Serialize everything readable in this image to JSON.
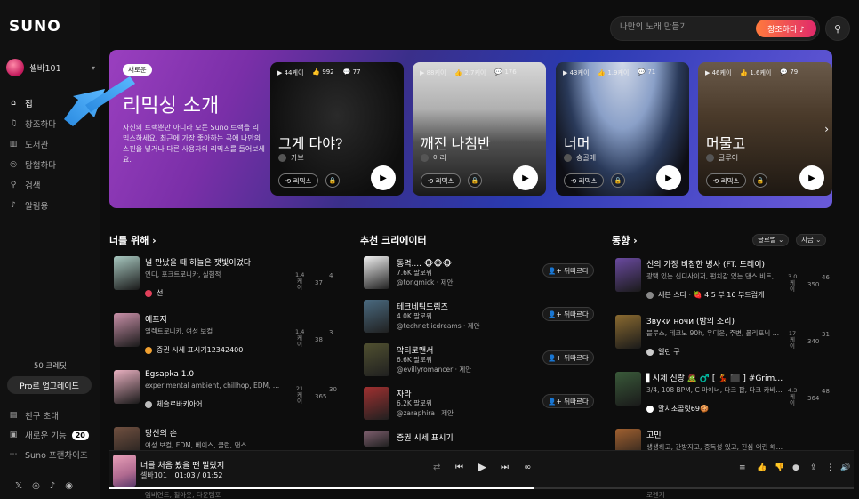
{
  "brand": "SUNO",
  "profile": {
    "name": "셀바101"
  },
  "nav": [
    {
      "icon": "home-icon",
      "glyph": "⌂",
      "label": "집"
    },
    {
      "icon": "music-note-icon",
      "glyph": "♫",
      "label": "창조하다"
    },
    {
      "icon": "library-icon",
      "glyph": "▥",
      "label": "도서관"
    },
    {
      "icon": "compass-icon",
      "glyph": "◎",
      "label": "탐험하다"
    },
    {
      "icon": "search-icon",
      "glyph": "⚲",
      "label": "검색"
    },
    {
      "icon": "bell-icon",
      "glyph": "♪",
      "label": "알림용"
    }
  ],
  "credits": "50 크레딧",
  "pro_button": "Pro로 업그레이드",
  "sub_nav": [
    {
      "icon": "invite-icon",
      "glyph": "▤",
      "label": "친구 초대"
    },
    {
      "icon": "gift-icon",
      "glyph": "▣",
      "label": "새로운 기능",
      "badge": "20"
    },
    {
      "icon": "dots-icon",
      "glyph": "⋯",
      "label": "Suno 프랜차이즈"
    }
  ],
  "socials": [
    "𝕏",
    "◎",
    "♪",
    "◉"
  ],
  "topbar": {
    "placeholder": "나만의 노래 만들기",
    "create": "창조하다 ♪",
    "search": "⚲"
  },
  "hero": {
    "badge": "새로운",
    "title": "리믹싱 소개",
    "desc": "자신의 트랙뿐만 아니라 모든 Suno 트랙을 리믹스하세요. 최근에 가장 좋아하는 곡에 나만의 스핀을 넣거나 다른 사용자의 리믹스를 들어보세요.",
    "cards": [
      {
        "plays": "▶ 44케이",
        "likes": "👍 992",
        "comments": "💬 77",
        "title": "그게 다야?",
        "artist": "카브",
        "remix": "⟲ 리믹스",
        "lock": "🔒",
        "play": "▶",
        "accent": "#3a3a3a"
      },
      {
        "plays": "▶ 88케이",
        "likes": "👍 2.7케이",
        "comments": "💬 176",
        "title": "깨진 나침반",
        "artist": "아리",
        "remix": "⟲ 리믹스",
        "lock": "🔒",
        "play": "▶",
        "accent": "#707070"
      },
      {
        "plays": "▶ 43케이",
        "likes": "👍 1.9케이",
        "comments": "💬 71",
        "title": "너머",
        "artist": "송골매",
        "remix": "⟲ 리믹스",
        "lock": "🔒",
        "play": "▶",
        "accent": "#8aa0c8"
      },
      {
        "plays": "▶ 46케이",
        "likes": "👍 1.6케이",
        "comments": "💬 79",
        "title": "머물고",
        "artist": "글루어",
        "remix": "⟲ 리믹스",
        "lock": "🔒",
        "play": "▶",
        "accent": "#6a5040"
      }
    ]
  },
  "for_you": {
    "title": "너를 위해 ›",
    "songs": [
      {
        "title": "널 만났을 때 하늘은 잿빛이었다",
        "tags": "인디, 포크트로니카, 실험적",
        "artist": "선",
        "plays": "1.4 케이",
        "likes": "37",
        "comments": "4",
        "thumb": "#a8c8c0",
        "dot": "#e0405a"
      },
      {
        "title": "에프지",
        "tags": "일렉트로니카, 여성 보컬",
        "artist": "증권 시세 표시기12342400",
        "plays": "1.4 케이",
        "likes": "38",
        "comments": "3",
        "thumb": "#c890a8",
        "dot": "#f0a030"
      },
      {
        "title": "Égsapka 1.0",
        "tags": "experimental ambient, chillhop, EDM, 펑가리어",
        "artist": "체슬로바키아어",
        "plays": "21 케이",
        "likes": "365",
        "comments": "30",
        "thumb": "#e8b0c0",
        "dot": "#bbbbbb"
      },
      {
        "title": "당신의 손",
        "tags": "여성 보컬, EDM, 베이스, 클럽, 댄스",
        "artist": "",
        "plays": "",
        "likes": "",
        "comments": "",
        "thumb": "#705040",
        "dot": "#888"
      }
    ]
  },
  "creators": {
    "title": "추천 크리에이터",
    "follow": "뒤따르다",
    "items": [
      {
        "name": "통먹.... 🐵🐵🐵",
        "followers": "7.6K 팔로워",
        "handle": "@tongmick · 제안",
        "color": "#f0f0f0"
      },
      {
        "name": "테크네틱드림즈",
        "followers": "4.0K 팔로워",
        "handle": "@technetiicdreams · 제안",
        "color": "#4a6a80"
      },
      {
        "name": "악티로맨서",
        "followers": "6.6K 팔로워",
        "handle": "@evillyromancer · 제안",
        "color": "#505030"
      },
      {
        "name": "자라",
        "followers": "6.2K 팔로워",
        "handle": "@zaraphira · 제안",
        "color": "#a03030"
      },
      {
        "name": "증권 시세 표시기",
        "followers": "",
        "handle": "",
        "color": "#806070"
      }
    ]
  },
  "trending": {
    "title": "동향 ›",
    "filter_global": "글로벌 ⌄",
    "filter_now": "지금 ⌄",
    "songs": [
      {
        "title": "신의 가장 비참한 병사 (FT. 드레이)",
        "tags": "광택 있는 신디사이저, 펀치감 있는 댄스 비트, 디지털 ...",
        "artist": "세븐 스타 · 🍓 4.5 부 16 부드럽게",
        "plays": "3.0 케이",
        "likes": "350",
        "comments": "46",
        "thumb": "#6a4aa0",
        "dot": "#888"
      },
      {
        "title": "Звуки ночи (밤의 소리)",
        "tags": "블루스, 테크노 90h, 우디운, 주변, 폴리포닉 보컬, 영국 ...",
        "artist": "엘런 구",
        "plays": "17 케이",
        "likes": "340",
        "comments": "31",
        "thumb": "#8a6a30",
        "dot": "#ccc"
      },
      {
        "title": "▌시체 신랑 🧟 ♂️ [ 💃 ⬛ ] #Grimvale / [🎃]...",
        "tags": "3/4, 108 BPM, C 마이너, 다크 팝, 다크 카바레, 고딕 발즈...",
        "artist": "말치초콜릿69🍪",
        "plays": "4.3 케이",
        "likes": "364",
        "comments": "48",
        "thumb": "#3a5a3a",
        "dot": "#fff"
      },
      {
        "title": "고민",
        "tags": "생생하고, 간방지고, 중독성 있고, 진심 어린 해비 팝 펑크",
        "artist": "",
        "plays": "",
        "likes": "",
        "comments": "",
        "thumb": "#a06030",
        "dot": "#888"
      }
    ]
  },
  "player": {
    "title": "너를 처음 봤을 땐 말랐지",
    "artist": "셀바101",
    "time": "01:03 / 01:52",
    "progress": 0.57
  },
  "below_player": "엠비언트, 칠아웃, 다운템포",
  "below_player_right": "로렌지"
}
